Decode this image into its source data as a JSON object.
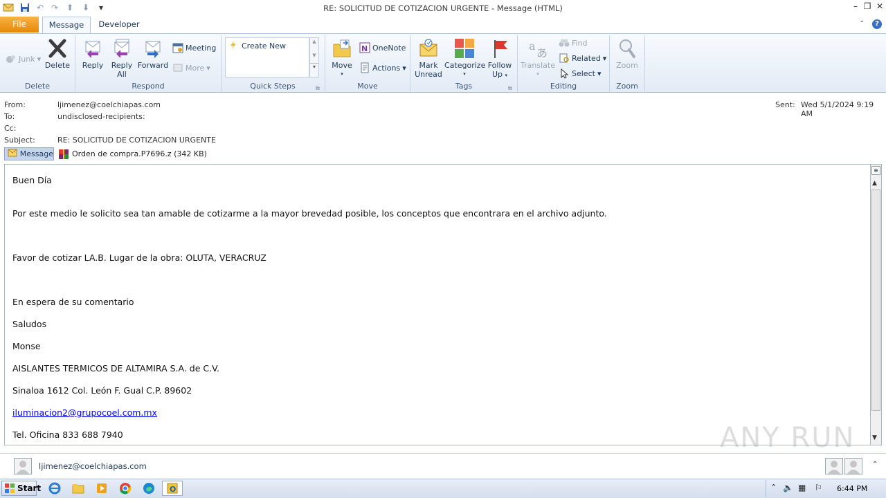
{
  "window": {
    "title": "RE: SOLICITUD DE COTIZACION URGENTE  -  Message (HTML)"
  },
  "tabs": {
    "file": "File",
    "message": "Message",
    "developer": "Developer"
  },
  "ribbon": {
    "delete_group": {
      "label": "Delete",
      "junk": "Junk",
      "delete": "Delete"
    },
    "respond_group": {
      "label": "Respond",
      "reply": "Reply",
      "reply_all_1": "Reply",
      "reply_all_2": "All",
      "forward": "Forward",
      "meeting": "Meeting",
      "more": "More"
    },
    "quick_steps_group": {
      "label": "Quick Steps",
      "create_new": "Create New"
    },
    "move_group": {
      "label": "Move",
      "move": "Move",
      "onenote": "OneNote",
      "actions": "Actions"
    },
    "tags_group": {
      "label": "Tags",
      "mark_unread_1": "Mark",
      "mark_unread_2": "Unread",
      "categorize": "Categorize",
      "follow_up_1": "Follow",
      "follow_up_2": "Up"
    },
    "editing_group": {
      "label": "Editing",
      "translate": "Translate",
      "find": "Find",
      "related": "Related",
      "select": "Select"
    },
    "zoom_group": {
      "label": "Zoom",
      "zoom": "Zoom"
    }
  },
  "header": {
    "from_label": "From:",
    "from_value": "ljimenez@coelchiapas.com",
    "to_label": "To:",
    "to_value": "undisclosed-recipients:",
    "cc_label": "Cc:",
    "subject_label": "Subject:",
    "subject_value": "RE: SOLICITUD DE COTIZACION URGENTE",
    "sent_label": "Sent:",
    "sent_value": "Wed 5/1/2024 9:19 AM"
  },
  "attachments": {
    "message_tab": "Message",
    "file": "Orden de compra.P7696.z (342 KB)"
  },
  "body": {
    "greeting": "Buen Día",
    "para1": "Por este medio le solicito sea tan amable de cotizarme a la mayor brevedad posible, los conceptos que encontrara en el archivo adjunto.",
    "para2": "Favor de cotizar LA.B. Lugar de la obra: OLUTA, VERACRUZ",
    "para3": "En espera de su comentario",
    "saludos": "Saludos",
    "name": "Monse",
    "company": "AISLANTES TERMICOS DE ALTAMIRA S.A. de C.V.",
    "address": "Sinaloa 1612 Col. León F. Gual C.P. 89602",
    "email": "iluminacion2@grupocoel.com.mx",
    "phone": "Tel. Oficina 833 688 7940"
  },
  "people_pane": {
    "sender": "ljimenez@coelchiapas.com"
  },
  "taskbar": {
    "start": "Start",
    "clock": "6:44 PM"
  },
  "watermark": "ANY RUN",
  "colors": {
    "file_tab": "#f39c1f",
    "ribbon_bg": "#e3ebf6",
    "link": "#0000ee"
  }
}
